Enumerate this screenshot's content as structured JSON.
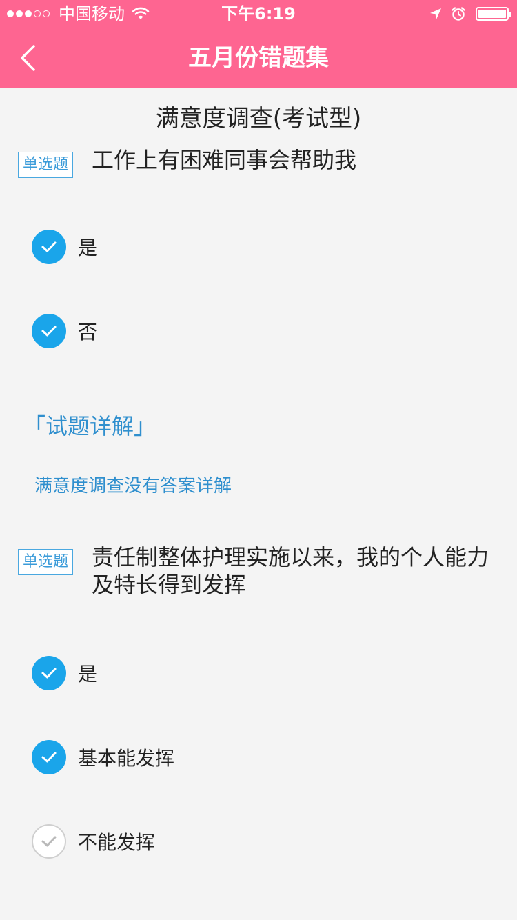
{
  "status_bar": {
    "carrier": "中国移动",
    "time": "下午6:19",
    "signal_bars_filled": 3,
    "signal_bars_total": 5,
    "battery_level": 1.0
  },
  "nav": {
    "title": "五月份错题集"
  },
  "survey": {
    "title": "满意度调查(考试型)"
  },
  "questions": [
    {
      "tag": "单选题",
      "text": "工作上有困难同事会帮助我",
      "options": [
        {
          "label": "是",
          "checked": true
        },
        {
          "label": "否",
          "checked": true
        }
      ],
      "explanation_heading": "「试题详解」",
      "explanation_text": "满意度调查没有答案详解"
    },
    {
      "tag": "单选题",
      "text": "责任制整体护理实施以来，我的个人能力及特长得到发挥",
      "options": [
        {
          "label": "是",
          "checked": true
        },
        {
          "label": "基本能发挥",
          "checked": true
        },
        {
          "label": "不能发挥",
          "checked": false
        }
      ]
    }
  ],
  "colors": {
    "header": "#fe6591",
    "accent": "#1aa5ea",
    "link": "#2f8fce"
  }
}
